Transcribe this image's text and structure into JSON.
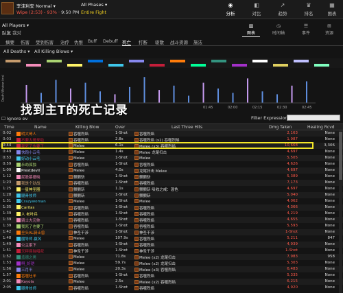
{
  "encounter": {
    "name": "李沫利安 Normal",
    "status": "Wipe (2:53) - 93%",
    "time": "9:50 PM",
    "phase": "All Phases",
    "fight": "Entire Fight"
  },
  "topnav": [
    {
      "label": "分析",
      "icon": "eye-icon",
      "glyph": "◉",
      "active": true
    },
    {
      "label": "对比",
      "icon": "compare-icon",
      "glyph": "◧",
      "active": false
    },
    {
      "label": "趋势",
      "icon": "trend-icon",
      "glyph": "↗",
      "active": false
    },
    {
      "label": "排名",
      "icon": "trophy-icon",
      "glyph": "♛",
      "active": false
    },
    {
      "label": "图表",
      "icon": "chart-icon",
      "glyph": "▦",
      "active": false
    }
  ],
  "players": {
    "label": "All Players",
    "team": "队友",
    "team2": "我对"
  },
  "views": [
    {
      "label": "图表",
      "glyph": "▥",
      "active": true
    },
    {
      "label": "时间轴",
      "glyph": "◷",
      "active": false
    },
    {
      "label": "事件",
      "glyph": "☰",
      "active": false
    },
    {
      "label": "资源",
      "glyph": "⊞",
      "active": false
    }
  ],
  "tabs": [
    "摘要",
    "伤害",
    "受到伤害",
    "治疗",
    "仇恨",
    "Buff",
    "Debuff",
    "死亡",
    "打断",
    "驱散",
    "战斗资源",
    "施法"
  ],
  "active_tab": "死亡",
  "filters": {
    "deaths": "All Deaths",
    "killing": "All Killing Blows"
  },
  "legend_colors": [
    "#c69b6d",
    "#f48cba",
    "#aad372",
    "#fff468",
    "#0070dd",
    "#3fc7eb",
    "#8788ee",
    "#c41e3a",
    "#ff7c0a",
    "#00ff98",
    "#33937f",
    "#a330c9",
    "#ffffff",
    "#e0d060",
    "#c0c0ff",
    "#80ffc0"
  ],
  "chart": {
    "ylabel": "Death Window (ms)",
    "ticks": [
      "01:45",
      "02:00",
      "02:15",
      "02:30",
      "02:45"
    ]
  },
  "chart_data": {
    "type": "bar",
    "ylabel": "Death Window (ms)",
    "categories": [
      "01:45",
      "02:00",
      "02:15",
      "02:30",
      "02:45"
    ],
    "values": [
      0.62,
      0.35,
      0.8,
      0.5,
      0.7,
      0.4,
      0.3,
      0.55,
      0.9,
      0.45,
      0.6,
      0.25,
      0.7,
      0.5,
      0.35,
      0.85,
      0.4,
      0.3,
      0.6,
      0.75
    ]
  },
  "overlay": "找到主T的死亡记录",
  "ignore_label": "Ignore ev",
  "filter_expression_label": "Filter Expression:",
  "columns": [
    "Time",
    "Name",
    "Killing Blow",
    "Over",
    "Last Three Hits",
    "Dmg Taken",
    "Healing Rcvd"
  ],
  "rows": [
    {
      "time": "0:02",
      "name": "明大哥人",
      "nc": "#ff7c0a",
      "kb": "吞噬烈焰",
      "over": "1-Shot",
      "hits": "吞噬烈焰",
      "dmg": "2,163",
      "heal": "None"
    },
    {
      "time": "0:03",
      "name": "不要大哥来啦",
      "nc": "#c41e3a",
      "kb": "吞噬烈焰",
      "over": "2.8s",
      "hits": "吞噬烈焰 (x2)  吞噬烈焰",
      "dmg": "1,987",
      "heal": "None"
    },
    {
      "time": "0:44",
      "name": "我死了也要了",
      "nc": "#c41e3a",
      "kb": "Melee",
      "over": "6.1s",
      "hits": "Melee (x3)  吞噬烈焰",
      "dmg": "10,668",
      "heal": "3,306"
    },
    {
      "time": "0:49",
      "name": "快跑小云毛",
      "nc": "#8788ee",
      "kb": "Melee",
      "over": "1.4s",
      "hits": "Melee  龙尾扫击",
      "dmg": "4,697",
      "heal": "None"
    },
    {
      "time": "0:53",
      "name": "好动小云毛",
      "nc": "#3fc7eb",
      "kb": "Melee",
      "over": "1-Shot",
      "hits": "Melee",
      "dmg": "5,505",
      "heal": "None"
    },
    {
      "time": "0:59",
      "name": "永劫孤独",
      "nc": "#aad372",
      "kb": "吞噬烈焰",
      "over": "1-Shot",
      "hits": "吞噬烈焰",
      "dmg": "4,626",
      "heal": "None"
    },
    {
      "time": "1:09",
      "name": "Prestdevil",
      "nc": "#ffffff",
      "kb": "Melee",
      "over": "4.0s",
      "hits": "龙尾扫击  Melee",
      "dmg": "4,697",
      "heal": "None"
    },
    {
      "time": "1:12",
      "name": "屁股慕德晓",
      "nc": "#f48cba",
      "kb": "颤颤斩",
      "over": "1-Shot",
      "hits": "颤颤斩",
      "dmg": "5,389",
      "heal": "None"
    },
    {
      "time": "1:23",
      "name": "我是个劲战",
      "nc": "#c69b6d",
      "kb": "吞噬烈焰",
      "over": "1-Shot",
      "hits": "吞噬烈焰",
      "dmg": "7,173",
      "heal": "None"
    },
    {
      "time": "1:25",
      "name": "一星神圣圈",
      "nc": "#fff468",
      "kb": "颤颤斩",
      "over": "1.1s",
      "hits": "颤颤斩  吸收之戒：混色",
      "dmg": "4,697",
      "heal": "None"
    },
    {
      "time": "1:28",
      "name": "腿骨技师",
      "nc": "#3fc7eb",
      "kb": "颤颤斩",
      "over": "1-Shot",
      "hits": "颤颤斩",
      "dmg": "5,040",
      "heal": "None"
    },
    {
      "time": "1:31",
      "name": "Crazywoman",
      "nc": "#3fc7eb",
      "kb": "Melee",
      "over": "1-Shot",
      "hits": "Melee",
      "dmg": "4,062",
      "heal": "None"
    },
    {
      "time": "1:35",
      "name": "Caritas",
      "nc": "#fff468",
      "kb": "吞噬烈焰",
      "over": "1-Shot",
      "hits": "吞噬烈焰",
      "dmg": "4,366",
      "heal": "None"
    },
    {
      "time": "1:39",
      "name": "人 老叶兵",
      "nc": "#fff468",
      "kb": "吞噬烈焰",
      "over": "1-Shot",
      "hits": "吞噬烈焰",
      "dmg": "4,219",
      "heal": "None"
    },
    {
      "time": "1:39",
      "name": "骑士大元帅",
      "nc": "#f48cba",
      "kb": "吞噬烈焰",
      "over": "1-Shot",
      "hits": "吞噬烈焰",
      "dmg": "4,655",
      "heal": "None"
    },
    {
      "time": "1:39",
      "name": "我死了也要了",
      "nc": "#aad372",
      "kb": "吞噬烈焰",
      "over": "1-Shot",
      "hits": "吞噬烈焰",
      "dmg": "5,593",
      "heal": "None"
    },
    {
      "time": "1:42",
      "name": "全头AL骑士兽",
      "nc": "#ff7c0a",
      "kb": "神圣干涉",
      "over": "1-Shot",
      "hits": "神圣干涉",
      "dmg": "1-Shot",
      "heal": "None"
    },
    {
      "time": "1:48",
      "name": "魔导师·赢风",
      "nc": "#3fc7eb",
      "kb": "Melee",
      "over": "107.9s",
      "hits": "吞噬烈焰",
      "dmg": "5,211",
      "heal": "847"
    },
    {
      "time": "1:49",
      "name": "公主家下",
      "nc": "#f48cba",
      "kb": "吞噬烈焰",
      "over": "1-Shot",
      "hits": "吞噬烈焰",
      "dmg": "4,939",
      "heal": "None"
    },
    {
      "time": "1:51",
      "name": "天秤座独唱叔",
      "nc": "#c41e3a",
      "kb": "神圣干涉",
      "over": "1-Shot",
      "hits": "神圣干涉",
      "dmg": "1-Shot",
      "heal": "None"
    },
    {
      "time": "1:52",
      "name": "孟德之男",
      "nc": "#33937f",
      "kb": "Melee",
      "over": "71.8s",
      "hits": "Melee (x2)  龙尾扫击",
      "dmg": "7,983",
      "heal": "958"
    },
    {
      "time": "1:53",
      "name": "啊_好铠",
      "nc": "#a330c9",
      "kb": "Melee",
      "over": "59.7s",
      "hits": "Melee (x2)  龙尾扫击",
      "dmg": "5,303",
      "heal": "None"
    },
    {
      "time": "1:56",
      "name": "三月半",
      "nc": "#8788ee",
      "kb": "Melee",
      "over": "20.3s",
      "hits": "Melee (x3)  吞噬烈焰",
      "dmg": "6,483",
      "heal": "None"
    },
    {
      "time": "1:57",
      "name": "吞噬吐半",
      "nc": "#ff7c0a",
      "kb": "吞噬烈焰",
      "over": "1-Shot",
      "hits": "吞噬烈焰",
      "dmg": "5,335",
      "heal": "None"
    },
    {
      "time": "2:01",
      "name": "Kayola",
      "nc": "#f48cba",
      "kb": "Melee",
      "over": "2.5s",
      "hits": "Melee (x2)  吞噬烈焰",
      "dmg": "6,215",
      "heal": "None"
    },
    {
      "time": "2:05",
      "name": "腿骨技师",
      "nc": "#3fc7eb",
      "kb": "吞噬烈焰",
      "over": "1-Shot",
      "hits": "吞噬烈焰",
      "dmg": "4,920",
      "heal": "None"
    }
  ]
}
